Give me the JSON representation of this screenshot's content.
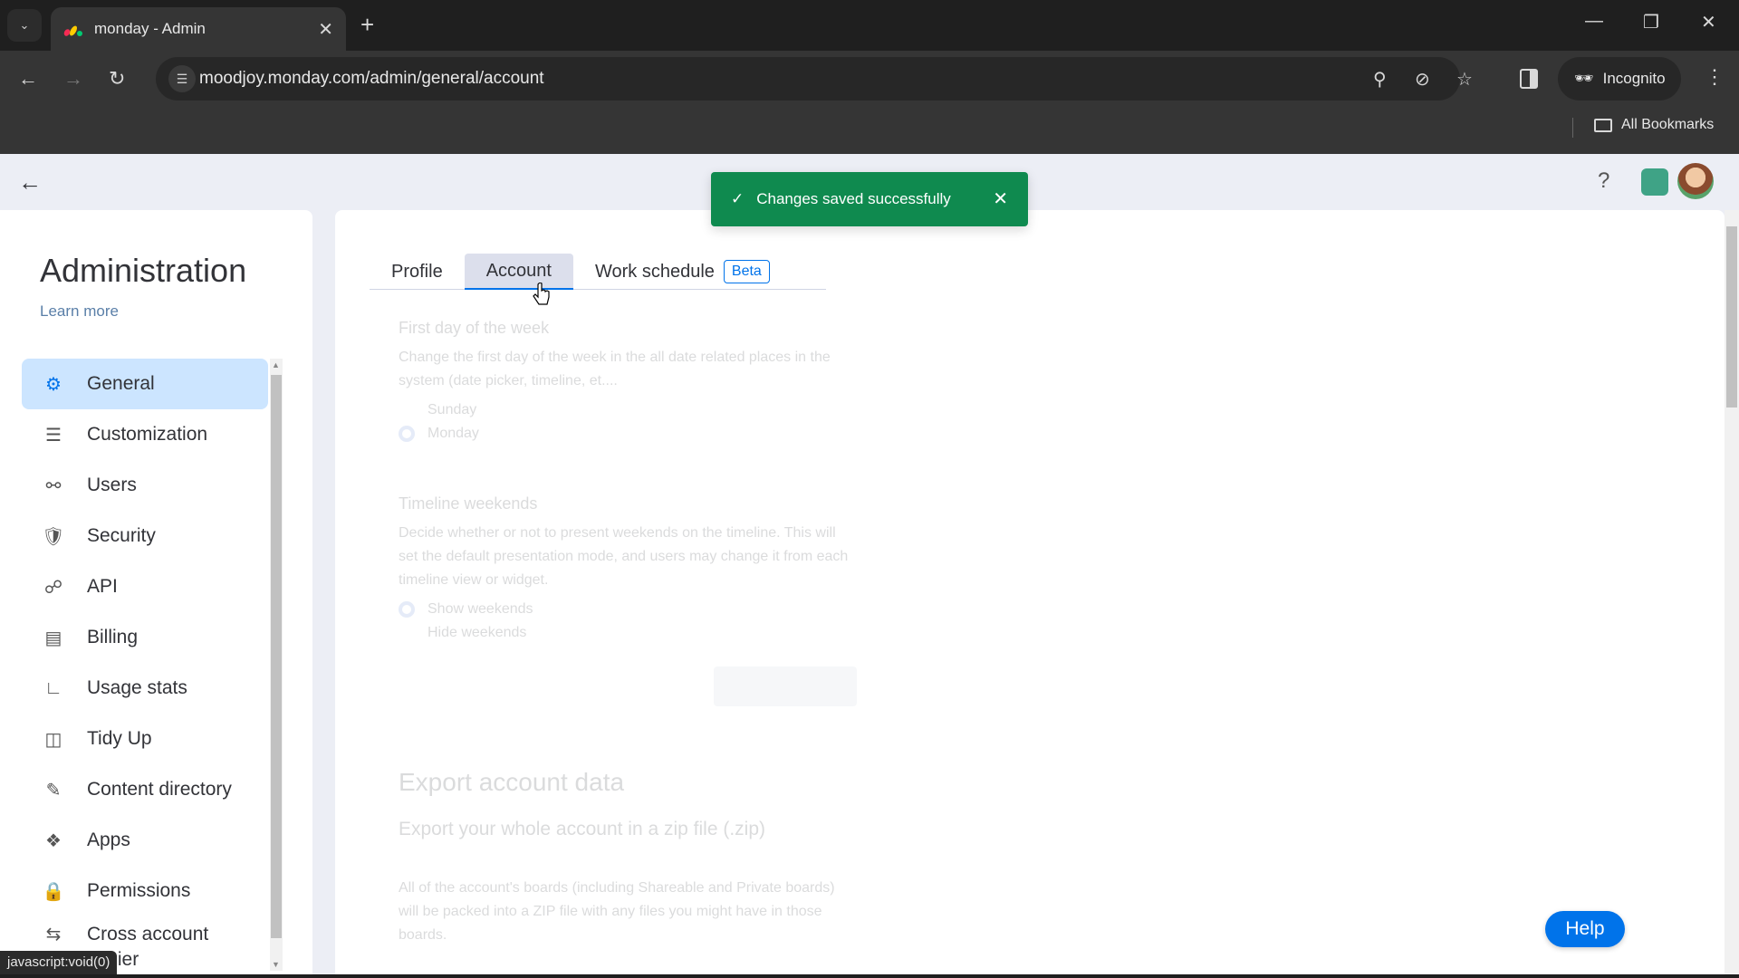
{
  "browser": {
    "tab_title": "monday - Admin",
    "url": "moodjoy.monday.com/admin/general/account",
    "incognito_label": "Incognito",
    "all_bookmarks_label": "All Bookmarks",
    "status_url": "javascript:void(0)"
  },
  "toast": {
    "message": "Changes saved successfully",
    "color": "#0f8a4f"
  },
  "sidebar": {
    "title": "Administration",
    "learn_more": "Learn more",
    "items": [
      {
        "label": "General",
        "icon": "gear-icon",
        "active": true
      },
      {
        "label": "Customization",
        "icon": "sliders-icon"
      },
      {
        "label": "Users",
        "icon": "users-icon"
      },
      {
        "label": "Security",
        "icon": "shield-icon"
      },
      {
        "label": "API",
        "icon": "api-icon"
      },
      {
        "label": "Billing",
        "icon": "credit-card-icon"
      },
      {
        "label": "Usage stats",
        "icon": "chart-icon"
      },
      {
        "label": "Tidy Up",
        "icon": "shredder-icon"
      },
      {
        "label": "Content directory",
        "icon": "edit-doc-icon"
      },
      {
        "label": "Apps",
        "icon": "puzzle-icon"
      },
      {
        "label": "Permissions",
        "icon": "lock-icon"
      },
      {
        "label": "Cross account copier",
        "icon": "copy-arrows-icon"
      }
    ]
  },
  "main": {
    "tabs": [
      {
        "label": "Profile"
      },
      {
        "label": "Account",
        "active": true
      },
      {
        "label": "Work schedule",
        "badge": "Beta"
      }
    ],
    "first_day": {
      "title": "First day of the week",
      "description": "Change the first day of the week in the all date related places in the system (date picker, timeline, et....",
      "options": [
        "Sunday",
        "Monday"
      ],
      "selected": "Monday"
    },
    "timeline_weekends": {
      "title": "Timeline weekends",
      "description": "Decide whether or not to present weekends on the timeline. This will set the default presentation mode, and users may change it from each timeline view or widget.",
      "options": [
        "Show weekends",
        "Hide weekends"
      ],
      "selected": "Show weekends"
    },
    "export": {
      "title": "Export account data",
      "subtitle": "Export your whole account in a zip file (.zip)",
      "description": "All of the account's boards (including Shareable and Private boards) will be packed into a ZIP file with any files you might have in those boards."
    }
  },
  "help_button": "Help",
  "accent_color": "#0073ea"
}
